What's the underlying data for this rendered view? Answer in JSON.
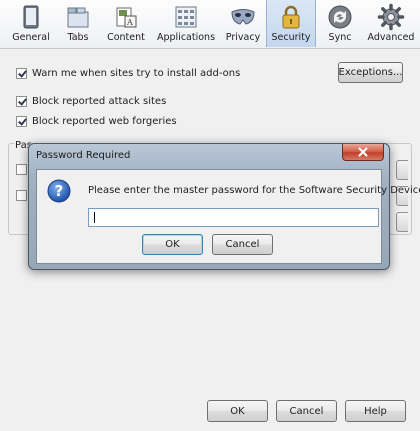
{
  "toolbar": {
    "tabs": [
      {
        "label": "General",
        "icon": "general-icon"
      },
      {
        "label": "Tabs",
        "icon": "tabs-icon"
      },
      {
        "label": "Content",
        "icon": "content-icon"
      },
      {
        "label": "Applications",
        "icon": "applications-icon"
      },
      {
        "label": "Privacy",
        "icon": "privacy-mask-icon"
      },
      {
        "label": "Security",
        "icon": "security-lock-icon",
        "active": true
      },
      {
        "label": "Sync",
        "icon": "sync-icon"
      },
      {
        "label": "Advanced",
        "icon": "advanced-gear-icon"
      }
    ]
  },
  "security": {
    "warn_addons": {
      "label": "Warn me when sites try to install add-ons",
      "checked": true
    },
    "exceptions_button": "Exceptions...",
    "block_attack": {
      "label": "Block reported attack sites",
      "checked": true
    },
    "block_forgeries": {
      "label": "Block reported web forgeries",
      "checked": true
    },
    "passwords_legend_partial": "Pas"
  },
  "dialog": {
    "title": "Password Required",
    "message": "Please enter the master password for the Software Security Device.",
    "password_value": "",
    "ok": "OK",
    "cancel": "Cancel",
    "icon": "question-icon"
  },
  "footer": {
    "ok": "OK",
    "cancel": "Cancel",
    "help": "Help"
  },
  "colors": {
    "active_tab": "#c4d7ef",
    "close_button": "#c1402a",
    "dialog_frame": "#9fb0c2"
  }
}
